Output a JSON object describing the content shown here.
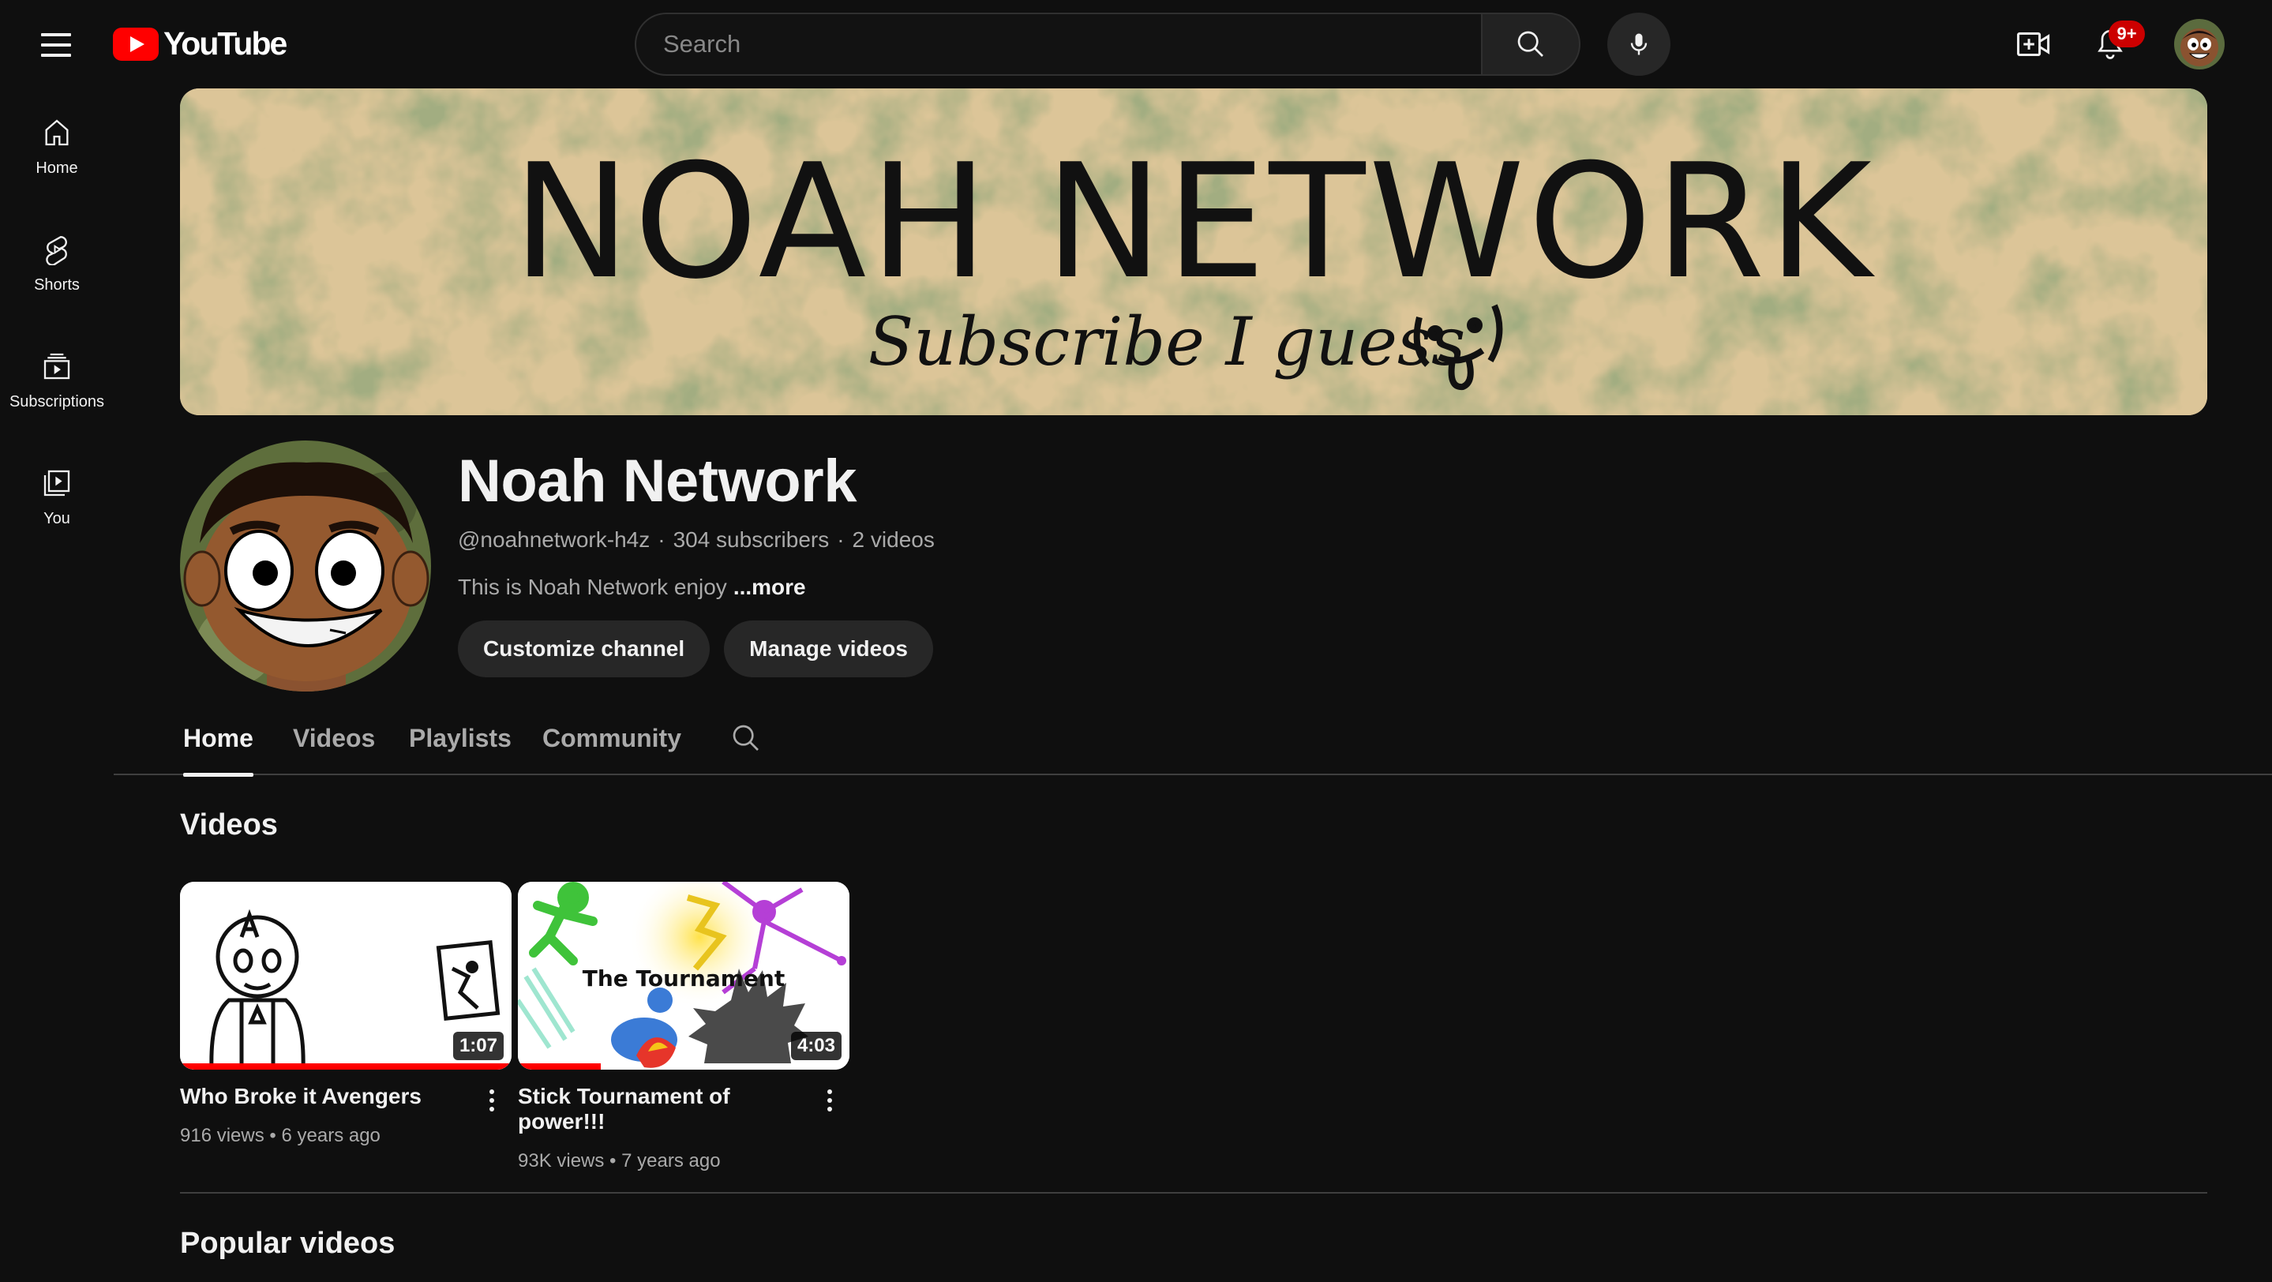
{
  "header": {
    "logo_text": "YouTube",
    "search_placeholder": "Search",
    "notification_count": "9+"
  },
  "guide": {
    "items": [
      {
        "label": "Home",
        "icon": "home-icon"
      },
      {
        "label": "Shorts",
        "icon": "shorts-icon"
      },
      {
        "label": "Subscriptions",
        "icon": "subscriptions-icon"
      },
      {
        "label": "You",
        "icon": "you-icon"
      }
    ]
  },
  "banner": {
    "title": "NOAH NETWORK",
    "subtitle": "Subscribe I guess"
  },
  "channel": {
    "name": "Noah Network",
    "handle": "@noahnetwork-h4z",
    "subscribers": "304 subscribers",
    "videos": "2 videos",
    "separator": "·",
    "description": "This is Noah Network enjoy",
    "more": "...more",
    "customize_label": "Customize channel",
    "manage_label": "Manage videos"
  },
  "tabs": {
    "items": [
      {
        "label": "Home",
        "active": true
      },
      {
        "label": "Videos",
        "active": false
      },
      {
        "label": "Playlists",
        "active": false
      },
      {
        "label": "Community",
        "active": false
      }
    ]
  },
  "sections": {
    "videos_title": "Videos",
    "popular_title": "Popular videos"
  },
  "videos": [
    {
      "title": "Who Broke it Avengers",
      "duration": "1:07",
      "views": "916 views",
      "age": "6 years ago",
      "watched_fraction": 1.0
    },
    {
      "title": "Stick Tournament of power!!!",
      "duration": "4:03",
      "views": "93K views",
      "age": "7 years ago",
      "watched_fraction": 0.25,
      "thumb_text": "The Tournament"
    }
  ],
  "colors": {
    "background": "#0f0f0f",
    "accent_red": "#ff0000",
    "badge_red": "#cc0000",
    "banner_tan": "#dcc598",
    "text_primary": "#f1f1f1",
    "text_secondary": "#aaaaaa"
  }
}
